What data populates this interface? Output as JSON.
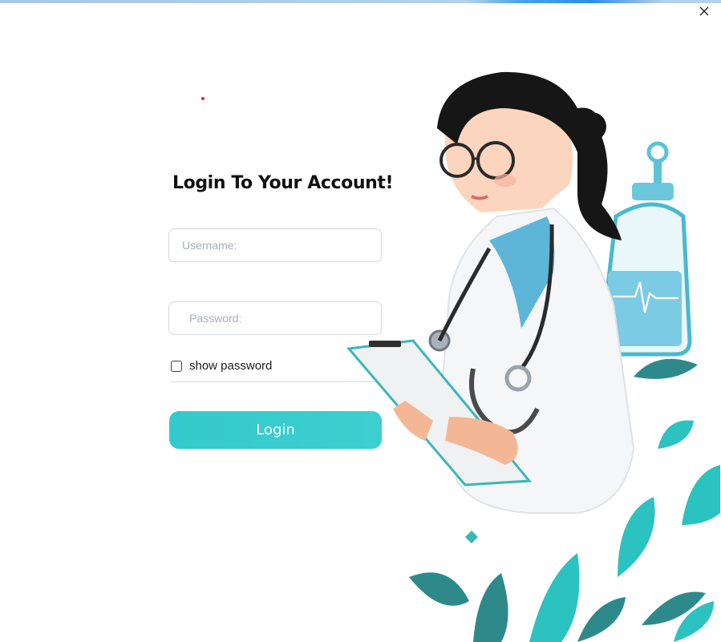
{
  "window": {
    "close_icon": "close-icon"
  },
  "login": {
    "title": "Login To Your Account!",
    "username_placeholder": "Username:",
    "username_value": "",
    "password_placeholder": "Password:",
    "password_value": "",
    "show_password_label": "show password",
    "show_password_checked": false,
    "login_label": "Login"
  },
  "colors": {
    "accent": "#36cacc",
    "leaf_dark": "#2e8a8a",
    "leaf_light": "#2cc2c0",
    "title": "#111111"
  },
  "illustration": {
    "subject": "doctor-with-clipboard-illustration"
  }
}
